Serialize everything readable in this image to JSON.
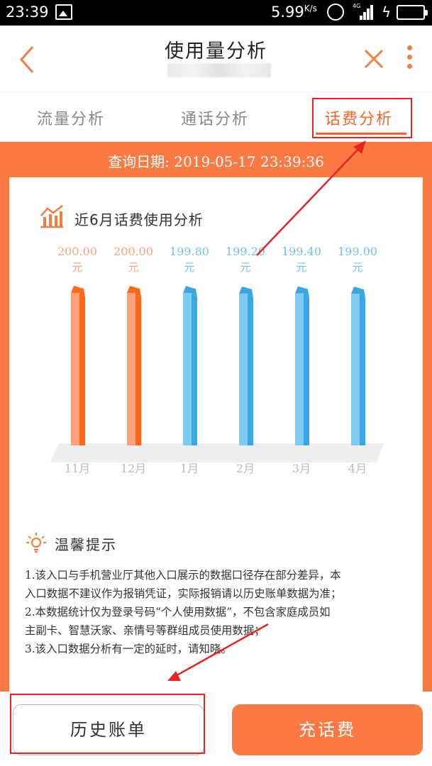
{
  "status_bar": {
    "time": "23:39",
    "net_speed": "5.99",
    "net_speed_unit": "K/s",
    "network_type": "4G"
  },
  "header": {
    "title": "使用量分析"
  },
  "tabs": [
    {
      "label": "流量分析",
      "active": false
    },
    {
      "label": "通话分析",
      "active": false
    },
    {
      "label": "话费分析",
      "active": true
    }
  ],
  "query": {
    "label": "查询日期:",
    "datetime": "2019-05-17  23:39:36"
  },
  "chart": {
    "title": "近6月话费使用分析"
  },
  "chart_data": {
    "type": "bar",
    "title": "近6月话费使用分析",
    "categories": [
      "11月",
      "12月",
      "1月",
      "2月",
      "3月",
      "4月"
    ],
    "values": [
      200.0,
      200.0,
      199.8,
      199.2,
      199.4,
      199.0
    ],
    "value_labels": [
      "200.00",
      "200.00",
      "199.80",
      "199.20",
      "199.40",
      "199.00"
    ],
    "unit": "元",
    "colors": [
      "#fb7a44",
      "#fb7a44",
      "#4fb6e8",
      "#4fb6e8",
      "#4fb6e8",
      "#4fb6e8"
    ],
    "grid": false
  },
  "tips": {
    "title": "温馨提示",
    "lines": [
      "1.该入口与手机营业厅其他入口展示的数据口径存在部分差异，本",
      "入口数据不建议作为报销凭证，实际报销请以历史账单数据为准；",
      "2.本数据统计仅为登录号码“个人使用数据”，不包含家庭成员如",
      "主副卡、智慧沃家、亲情号等群组成员使用数据；",
      "3.该入口数据分析有一定的延时，请知晓。"
    ]
  },
  "buttons": {
    "history": "历史账单",
    "recharge": "充话费"
  },
  "colors": {
    "accent": "#fb7a44",
    "active_tab": "#f0692b",
    "bar_blue": "#4fb6e8",
    "highlight_box": "#e42524"
  }
}
